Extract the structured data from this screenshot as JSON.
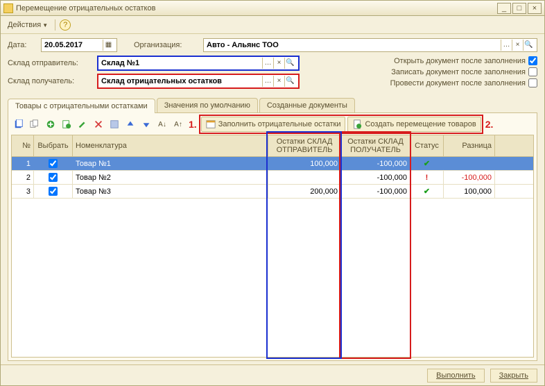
{
  "window": {
    "title": "Перемещение отрицательных остатков"
  },
  "toolbar": {
    "actions": "Действия"
  },
  "form": {
    "date_label": "Дата:",
    "date_value": "20.05.2017",
    "org_label": "Организация:",
    "org_value": "Авто - Альянс ТОО",
    "sender_label": "Склад отправитель:",
    "sender_value": "Склад №1",
    "receiver_label": "Склад получатель:",
    "receiver_value": "Склад отрицательных остатков"
  },
  "options": {
    "open_after": "Открыть документ после заполнения",
    "save_after": "Записать документ после заполнения",
    "post_after": "Провести документ после заполнения"
  },
  "tabs": {
    "t1": "Товары с отрицательными остатками",
    "t2": "Значения по умолчанию",
    "t3": "Созданные документы"
  },
  "buttons": {
    "fill": "Заполнить отрицательные остатки",
    "create": "Создать перемещение товаров"
  },
  "annotations": {
    "n1": "1.",
    "n2": "2."
  },
  "grid": {
    "headers": {
      "n": "№",
      "sel": "Выбрать",
      "nom": "Номенклатура",
      "out": "Остатки СКЛАД ОТПРАВИТЕЛЬ",
      "in": "Остатки СКЛАД ПОЛУЧАТЕЛЬ",
      "stat": "Статус",
      "diff": "Разница"
    },
    "rows": [
      {
        "n": "1",
        "nom": "Товар №1",
        "out": "100,000",
        "in": "-100,000",
        "stat": "ok",
        "diff": ""
      },
      {
        "n": "2",
        "nom": "Товар №2",
        "out": "",
        "in": "-100,000",
        "stat": "warn",
        "diff": "-100,000"
      },
      {
        "n": "3",
        "nom": "Товар №3",
        "out": "200,000",
        "in": "-100,000",
        "stat": "ok",
        "diff": "100,000"
      }
    ]
  },
  "footer": {
    "run": "Выполнить",
    "close": "Закрыть"
  }
}
